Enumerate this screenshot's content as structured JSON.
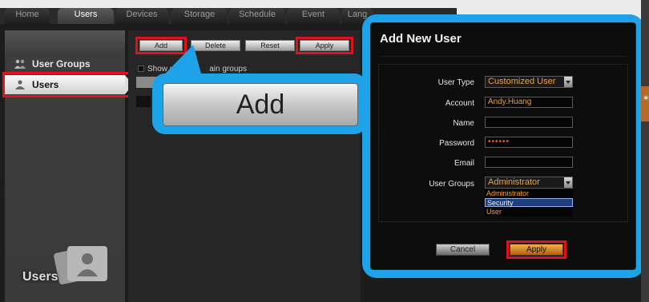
{
  "tabs": [
    {
      "label": "Home",
      "active": false
    },
    {
      "label": "Users",
      "active": true
    },
    {
      "label": "Devices",
      "active": false
    },
    {
      "label": "Storage",
      "active": false
    },
    {
      "label": "Schedule",
      "active": false
    },
    {
      "label": "Event",
      "active": false
    },
    {
      "label": "Lang",
      "active": false
    }
  ],
  "sidebar": {
    "items": [
      {
        "label": "User Groups",
        "icon": "user-groups-icon",
        "selected": false
      },
      {
        "label": "Users",
        "icon": "user-icon",
        "selected": true
      }
    ],
    "section_label": "Users",
    "section_icon": "users-folder-icon"
  },
  "toolbar": {
    "add_label": "Add",
    "delete_label": "Delete",
    "reset_label": "Reset",
    "apply_label": "Apply"
  },
  "show_users": {
    "label_start": "Show user",
    "label_end": "ain groups"
  },
  "callout": {
    "label": "Add"
  },
  "dialog": {
    "title": "Add New User",
    "fields": {
      "user_type": {
        "label": "User Type",
        "value": "Customized User"
      },
      "account": {
        "label": "Account",
        "value": "Andy.Huang"
      },
      "name": {
        "label": "Name",
        "value": ""
      },
      "password": {
        "label": "Password",
        "value": "••••••"
      },
      "email": {
        "label": "Email",
        "value": ""
      },
      "user_groups": {
        "label": "User Groups",
        "value": "Administrator",
        "options": [
          "Administrator",
          "Security",
          "User"
        ],
        "highlighted": "Security"
      }
    },
    "cancel_label": "Cancel",
    "apply_label": "Apply"
  },
  "colors": {
    "highlight_red": "#e0121c",
    "callout_blue": "#1ea3e8",
    "input_text_orange": "#f0a040",
    "apply_orange": "#f6b04a"
  }
}
